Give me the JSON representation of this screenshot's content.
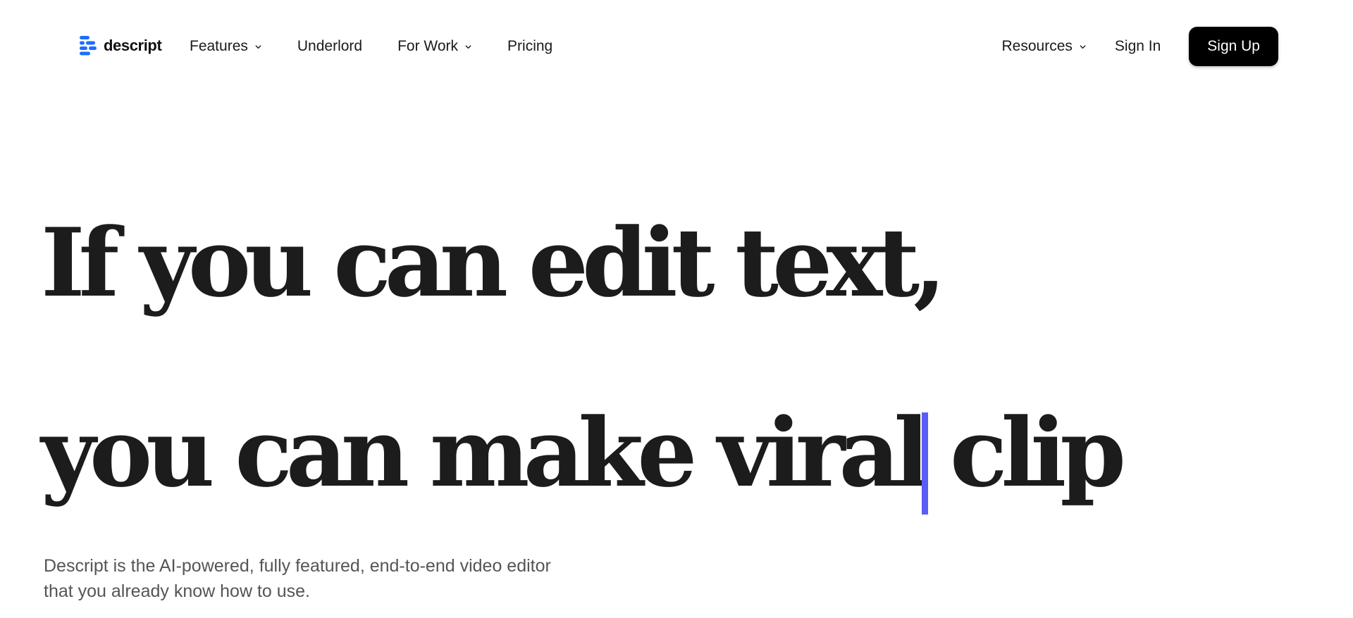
{
  "brand": {
    "name": "descript",
    "accent_color": "#1f6bff",
    "icon": "descript-logo-icon"
  },
  "nav": {
    "left_items": [
      {
        "label": "Features",
        "has_dropdown": true
      },
      {
        "label": "Underlord",
        "has_dropdown": false
      },
      {
        "label": "For Work",
        "has_dropdown": true
      },
      {
        "label": "Pricing",
        "has_dropdown": false
      }
    ],
    "resources": {
      "label": "Resources",
      "has_dropdown": true
    },
    "sign_in": "Sign In",
    "sign_up": "Sign Up"
  },
  "hero": {
    "line1": "If you can edit text,",
    "line2": "you can make viral clip",
    "caret_color": "#5a5cf6",
    "subtext_line1": "Descript is the AI-powered, fully featured, end-to-end video editor",
    "subtext_line2": "that you already know how to use."
  }
}
